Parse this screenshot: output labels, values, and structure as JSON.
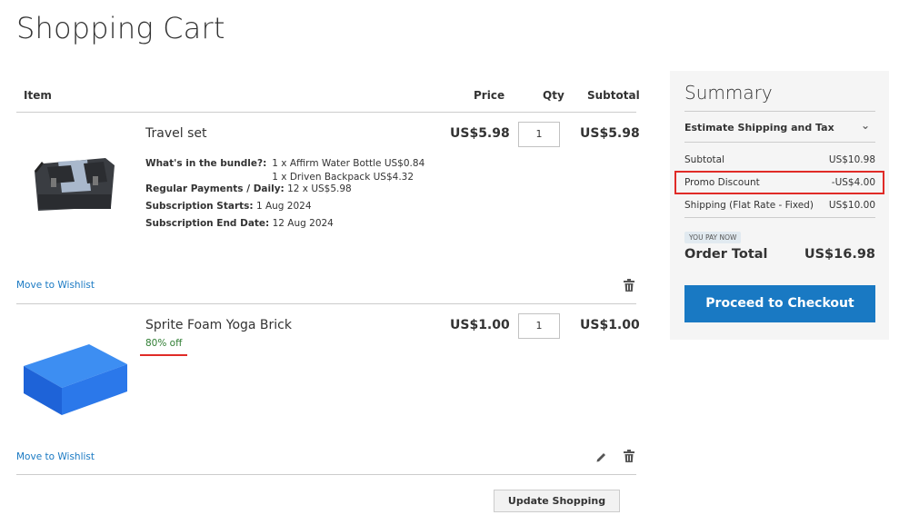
{
  "page": {
    "title": "Shopping Cart"
  },
  "columns": {
    "item": "Item",
    "price": "Price",
    "qty": "Qty",
    "subtotal": "Subtotal"
  },
  "items": [
    {
      "name": "Travel set",
      "price": "US$5.98",
      "qty": "1",
      "subtotal": "US$5.98",
      "bundle_label": "What's in the bundle?:",
      "bundle_lines": [
        "1 x Affirm Water Bottle US$0.84",
        "1 x Driven Backpack US$4.32"
      ],
      "options": [
        {
          "label": "Regular Payments / Daily:",
          "value": "12 x US$5.98"
        },
        {
          "label": "Subscription Starts:",
          "value": "1 Aug 2024"
        },
        {
          "label": "Subscription End Date:",
          "value": "12 Aug 2024"
        }
      ],
      "wishlist": "Move to Wishlist"
    },
    {
      "name": "Sprite Foam Yoga Brick",
      "discount": "80% off",
      "price": "US$1.00",
      "qty": "1",
      "subtotal": "US$1.00",
      "wishlist": "Move to Wishlist"
    }
  ],
  "update_button": "Update Shopping Cart",
  "summary": {
    "title": "Summary",
    "estimate": "Estimate Shipping and Tax",
    "rows": [
      {
        "label": "Subtotal",
        "value": "US$10.98"
      },
      {
        "label": "Promo Discount",
        "value": "-US$4.00"
      },
      {
        "label": "Shipping (Flat Rate - Fixed)",
        "value": "US$10.00"
      }
    ],
    "pay_badge": "YOU PAY NOW",
    "order_total_label": "Order Total",
    "order_total_value": "US$16.98",
    "checkout_button": "Proceed to Checkout"
  },
  "colors": {
    "accent": "#1979c3",
    "highlight": "#e02b27",
    "discount": "#2e7d32"
  },
  "icons": [
    "chevron-down-icon",
    "trash-icon",
    "pencil-icon"
  ]
}
